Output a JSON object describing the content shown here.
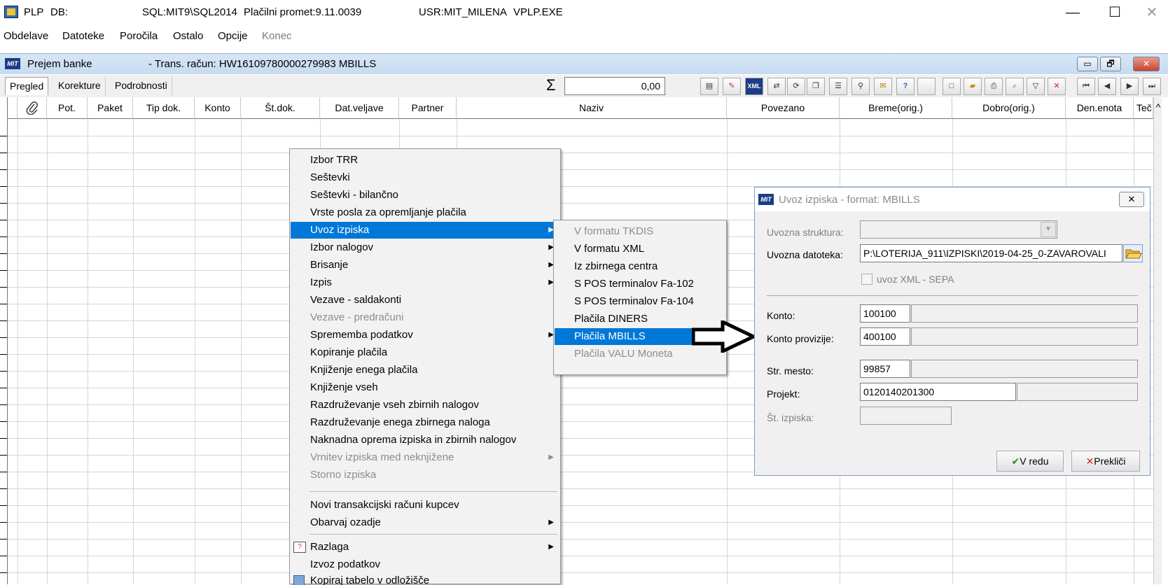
{
  "window": {
    "app": "PLP",
    "db_label": "DB:",
    "server": "SQL:MIT9\\SQL2014",
    "module": "Plačilni promet:9.11.0039",
    "user": "USR:MIT_MILENA",
    "exe": "VPLP.EXE",
    "minimize": "—",
    "maximize": "☐",
    "close": "✕"
  },
  "menubar": [
    "Obdelave",
    "Datoteke",
    "Poročila",
    "Ostalo",
    "Opcije",
    "Konec"
  ],
  "mdi": {
    "icon": "MIT",
    "title": "Prejem banke",
    "account": "- Trans. račun: HW16109780000279983  MBILLS",
    "btn_min": "▭",
    "btn_restore": "🗗",
    "btn_close": "✕"
  },
  "tabs": [
    "Pregled",
    "Korekture",
    "Podrobnosti"
  ],
  "sum": {
    "symbol": "Σ",
    "value": "0,00"
  },
  "toolbar_xml": "XML",
  "grid": {
    "attach_icon": "paperclip-icon",
    "columns": [
      "Pot.",
      "Paket",
      "Tip dok.",
      "Konto",
      "Št.dok.",
      "Dat.veljave",
      "Partner",
      "Naziv",
      "Povezano",
      "Breme(orig.)",
      "Dobro(orig.)",
      "Den.enota",
      "Teč"
    ],
    "scroll_up": "^"
  },
  "context_menu": {
    "items": [
      {
        "label": "Izbor TRR"
      },
      {
        "label": "Seštevki"
      },
      {
        "label": "Seštevki - bilančno"
      },
      {
        "label": "Vrste posla za opremljanje plačila"
      },
      {
        "label": "Uvoz izpiska",
        "sub": true
      },
      {
        "label": "Izbor nalogov",
        "sub": true
      },
      {
        "label": "Brisanje",
        "sub": true
      },
      {
        "label": "Izpis",
        "sub": true
      },
      {
        "label": "Vezave - saldakonti"
      },
      {
        "label": "Vezave - predračuni"
      },
      {
        "label": "Sprememba podatkov",
        "sub": true
      },
      {
        "label": "Kopiranje plačila"
      },
      {
        "label": "Knjiženje enega plačila"
      },
      {
        "label": "Knjiženje vseh"
      },
      {
        "label": "Razdruževanje vseh zbirnih nalogov"
      },
      {
        "label": "Razdruževanje enega zbirnega naloga"
      },
      {
        "label": "Naknadna oprema izpiska in zbirnih nalogov"
      },
      {
        "label": "Vrnitev izpiska med neknjižene",
        "sub": true
      },
      {
        "label": "Storno izpiska"
      },
      {
        "label": "Novi transakcijski računi kupcev"
      },
      {
        "label": "Obarvaj ozadje",
        "sub": true
      },
      {
        "label": "Razlaga",
        "sub": true
      },
      {
        "label": "Izvoz podatkov"
      },
      {
        "label": "Kopiraj tabelo v odložišče"
      }
    ]
  },
  "submenu": {
    "items": [
      {
        "label": "V formatu TKDIS"
      },
      {
        "label": "V formatu XML"
      },
      {
        "label": "Iz zbirnega centra"
      },
      {
        "label": "S POS terminalov Fa-102"
      },
      {
        "label": "S POS terminalov Fa-104"
      },
      {
        "label": "Plačila DINERS"
      },
      {
        "label": "Plačila MBILLS"
      },
      {
        "label": "Plačila VALU Moneta"
      }
    ]
  },
  "dialog": {
    "icon": "MIT",
    "title": "Uvoz izpiska - format: MBILLS",
    "close": "✕",
    "labels": {
      "struktura": "Uvozna struktura:",
      "datoteka": "Uvozna datoteka:",
      "sepa": "uvoz XML - SEPA",
      "konto": "Konto:",
      "provizija": "Konto provizije:",
      "strmesto": "Str. mesto:",
      "projekt": "Projekt:",
      "izpiska": "Št. izpiska:"
    },
    "values": {
      "datoteka": "P:\\LOTERIJA_911\\IZPISKI\\2019-04-25_0-ZAVAROVALI",
      "konto": "100100",
      "provizija": "400100",
      "strmesto": "99857",
      "projekt": "0120140201300"
    },
    "ok": "V redu",
    "cancel": "Prekliči",
    "ok_icon": "✔",
    "cancel_icon": "✕"
  },
  "colors": {
    "highlight": "#0078d7",
    "title_gradient": "#c6dbf1"
  }
}
